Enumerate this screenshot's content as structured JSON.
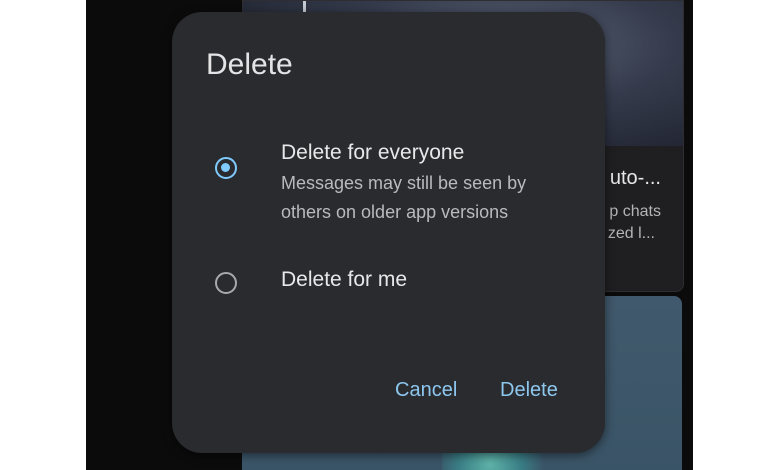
{
  "background": {
    "card_title": "uto-...",
    "card_line1": "p chats",
    "card_line2": "zed l..."
  },
  "dialog": {
    "title": "Delete",
    "options": [
      {
        "label": "Delete for everyone",
        "description": "Messages may still be seen by others on older app versions",
        "selected": true
      },
      {
        "label": "Delete for me",
        "description": "",
        "selected": false
      }
    ],
    "cancel_label": "Cancel",
    "confirm_label": "Delete"
  },
  "colors": {
    "accent": "#7fcbff",
    "dialog_bg": "#2a2b2e",
    "button_text": "#8dc7f0"
  },
  "icons": [
    "radio-selected-icon",
    "radio-unselected-icon"
  ]
}
